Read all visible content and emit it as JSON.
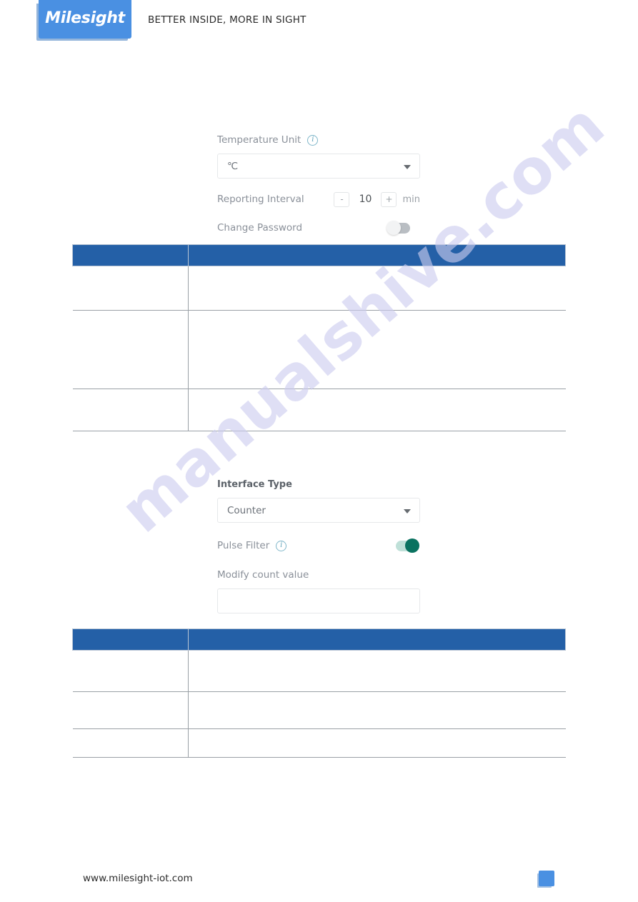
{
  "header": {
    "logo_text": "Milesight",
    "tagline": "BETTER INSIDE, MORE IN SIGHT",
    "logo_color": "#4a90e2"
  },
  "general_settings": {
    "temperature_unit": {
      "label": "Temperature Unit",
      "info_icon": "info-circle-icon",
      "value": "℃"
    },
    "reporting_interval": {
      "label": "Reporting Interval",
      "decrement_label": "-",
      "value": "10",
      "increment_label": "+",
      "unit": "min"
    },
    "change_password": {
      "label": "Change Password",
      "state": "off"
    }
  },
  "general_table": {
    "columns": [
      "",
      ""
    ],
    "rows": [
      [
        "",
        ""
      ],
      [
        "",
        ""
      ],
      [
        "",
        ""
      ]
    ]
  },
  "interface_settings": {
    "interface_type": {
      "label": "Interface Type",
      "value": "Counter"
    },
    "pulse_filter": {
      "label": "Pulse Filter",
      "info_icon": "info-circle-icon",
      "state": "on"
    },
    "modify_count_value": {
      "label": "Modify count value",
      "value": "",
      "placeholder": ""
    }
  },
  "interface_table": {
    "columns": [
      "",
      ""
    ],
    "rows": [
      [
        "",
        ""
      ],
      [
        "",
        ""
      ],
      [
        "",
        ""
      ]
    ]
  },
  "watermark": {
    "text": "manualshive.com",
    "color": "#ccccef"
  },
  "footer": {
    "url": "www.milesight-iot.com",
    "page_number": "",
    "badge_color": "#4a90e2"
  },
  "colors": {
    "table_header": "#2460a7",
    "toggle_on": "#0a7260",
    "toggle_off": "#b9bec3",
    "info_icon": "#5fa3ba"
  }
}
